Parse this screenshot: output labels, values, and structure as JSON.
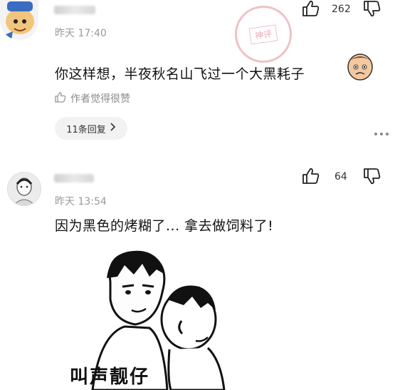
{
  "comments": [
    {
      "time": "昨天 17:40",
      "likes": "262",
      "content": "你这样想，半夜秋名山飞过一个大黑耗子",
      "author_liked": "作者觉得很赞",
      "replies_label": "11条回复",
      "stamp": "神评"
    },
    {
      "time": "昨天 13:54",
      "likes": "64",
      "content": "因为黑色的烤糊了... 拿去做饲料了!",
      "meme_caption": "叫声靓仔"
    }
  ],
  "icons": {
    "like": "thumbs-up-icon",
    "dislike": "thumbs-down-icon",
    "more": "more-dots-icon",
    "chevron": "chevron-right-icon"
  }
}
